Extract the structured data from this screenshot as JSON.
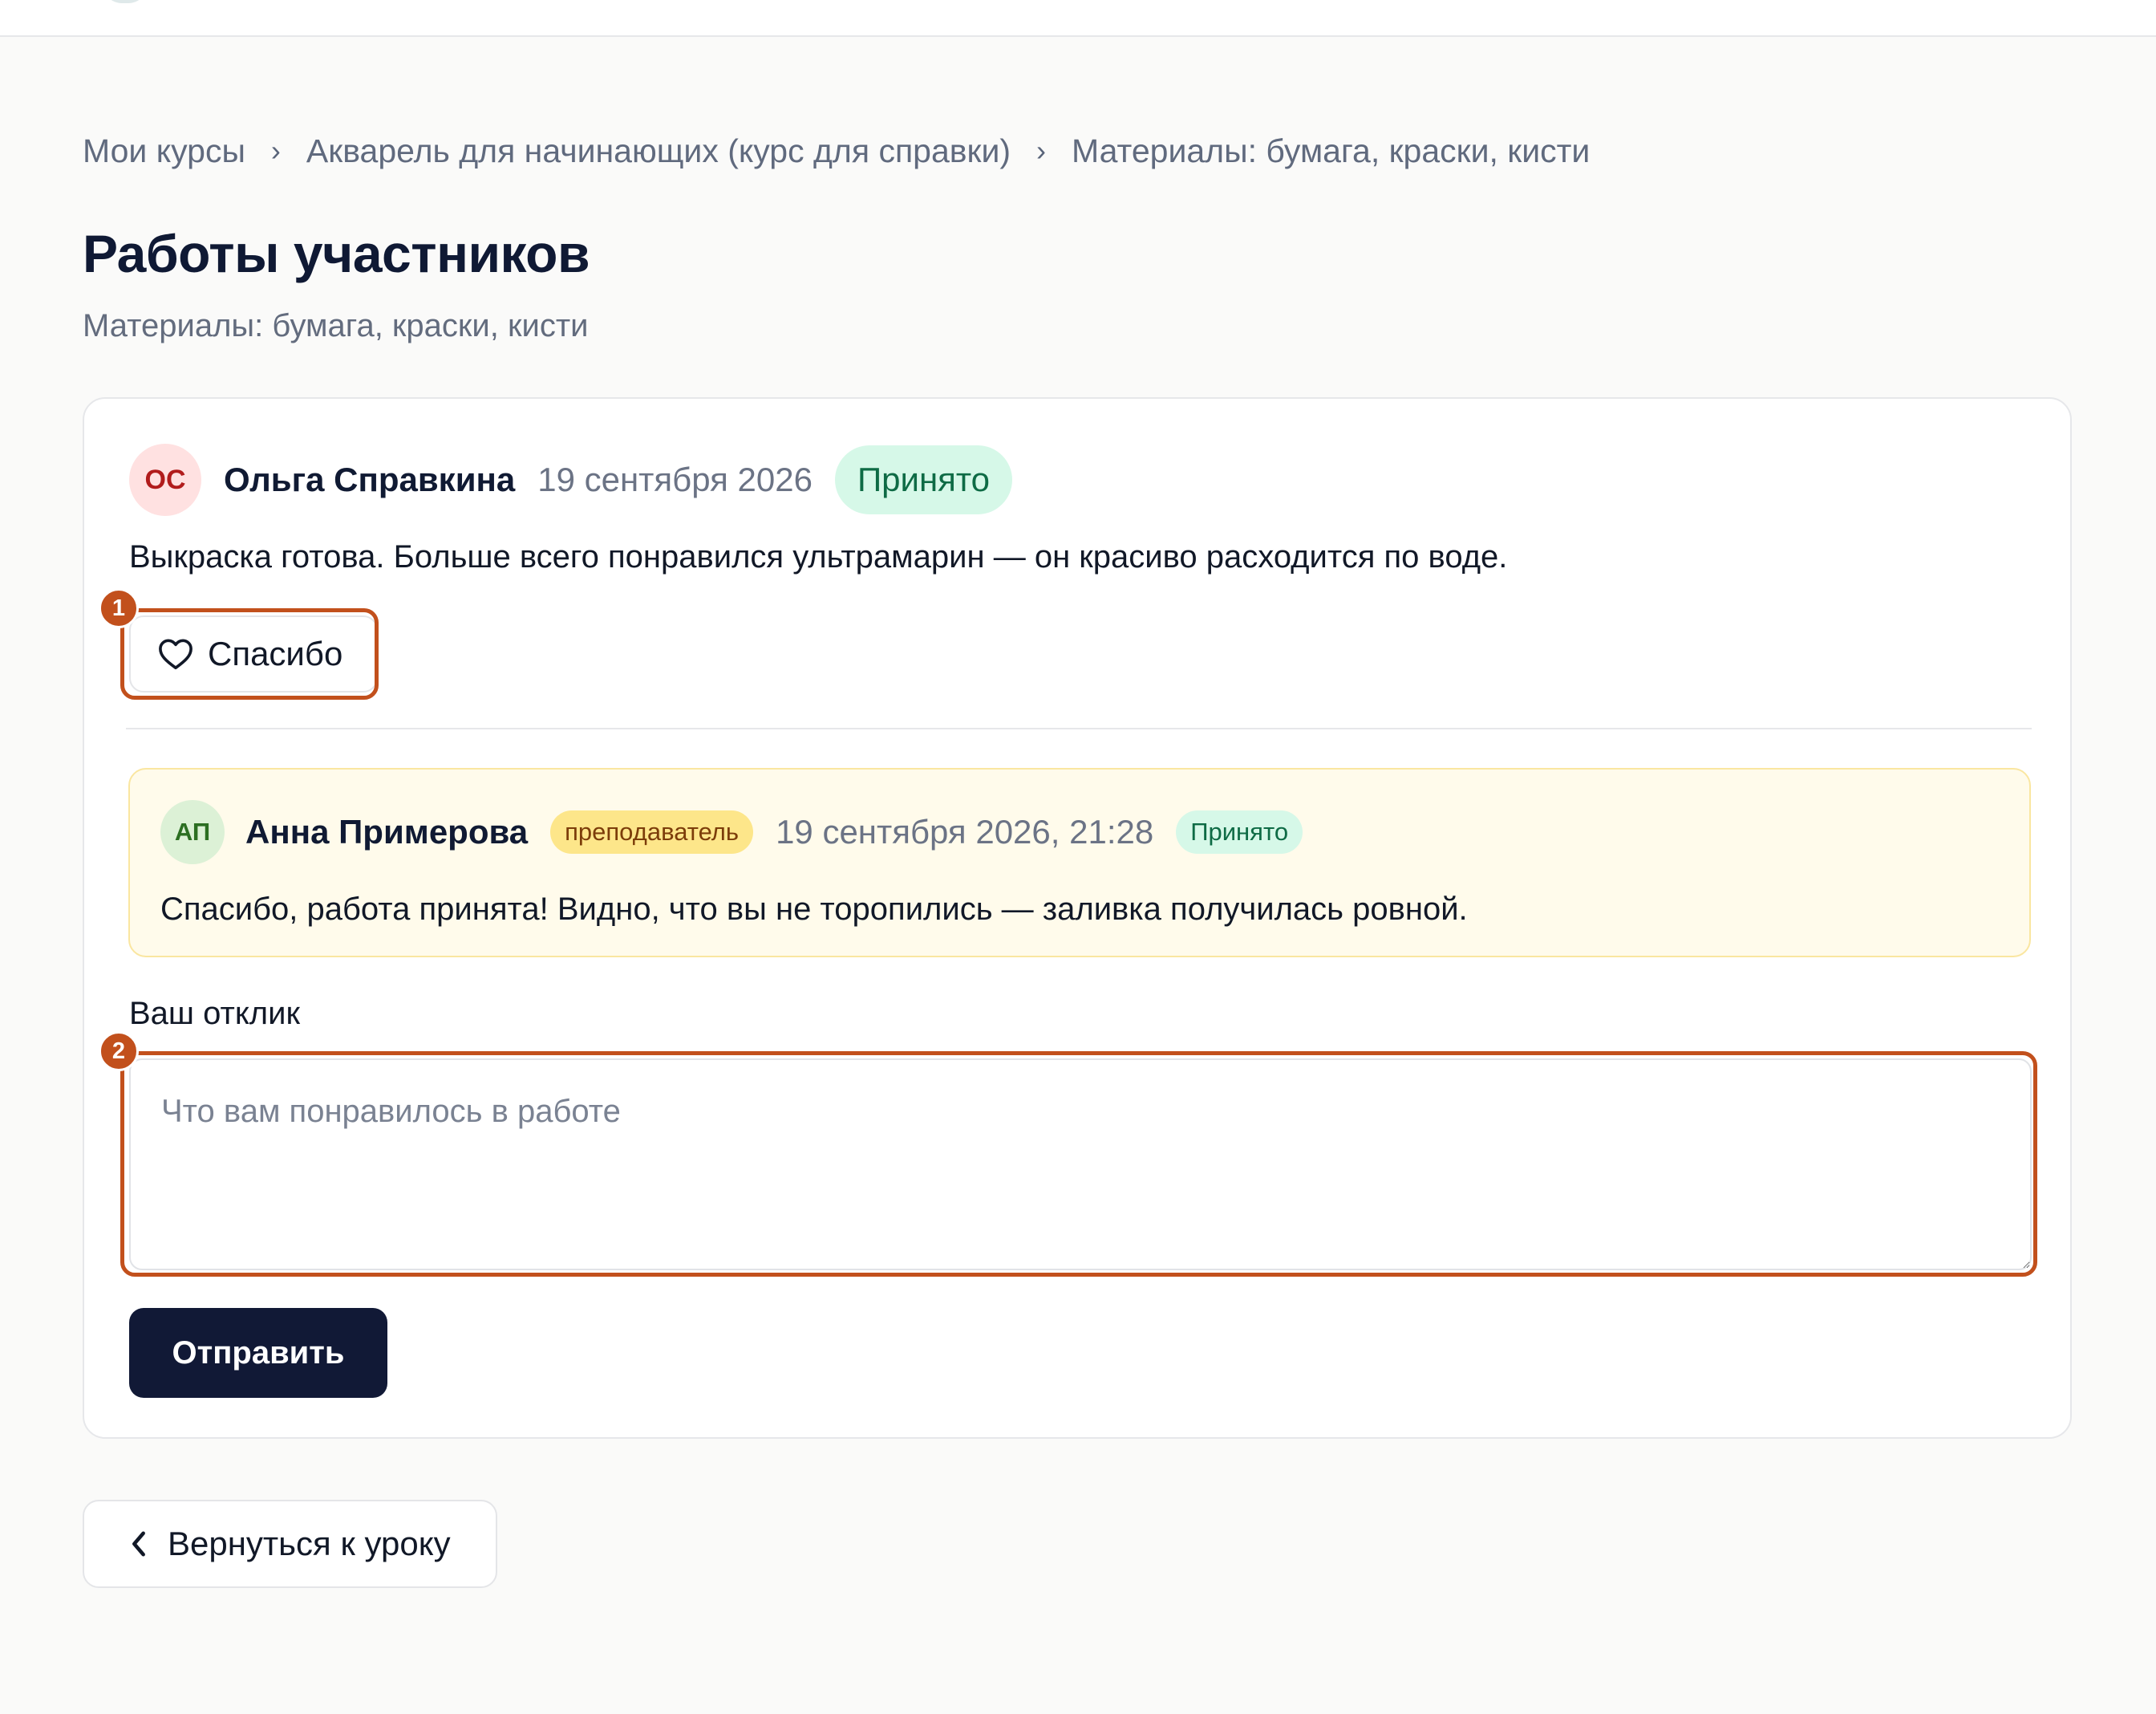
{
  "breadcrumb": {
    "items": [
      "Мои курсы",
      "Акварель для начинающих (курс для справки)",
      "Материалы: бумага, краски, кисти"
    ],
    "separator": "›"
  },
  "page": {
    "title": "Работы участников",
    "subtitle": "Материалы: бумага, краски, кисти"
  },
  "submission": {
    "avatar_initials": "ОС",
    "author": "Ольга Справкина",
    "date": "19 сентября 2026",
    "status": "Принято",
    "text": "Выкраска готова. Больше всего понравился ультрамарин — он красиво расходится по воде.",
    "thanks_label": "Спасибо",
    "thanks_icon": "heart-icon"
  },
  "reply": {
    "avatar_initials": "АП",
    "author": "Анна Примерова",
    "role": "преподаватель",
    "date": "19 сентября 2026, 21:28",
    "status": "Принято",
    "text": "Спасибо, работа принята! Видно, что вы не торопились — заливка получилась ровной."
  },
  "response_form": {
    "label": "Ваш отклик",
    "value": "",
    "placeholder": "Что вам понравилось в работе",
    "submit_label": "Отправить"
  },
  "back": {
    "label": "Вернуться к уроку",
    "icon": "chevron-left-icon"
  },
  "markers": [
    "1",
    "2"
  ],
  "colors": {
    "accent_dark": "#111936",
    "status_bg": "#d6f8e8",
    "status_text": "#0e6b45",
    "role_bg": "#fde68a",
    "reply_bg": "#fffbeb",
    "marker": "#c2501c"
  }
}
